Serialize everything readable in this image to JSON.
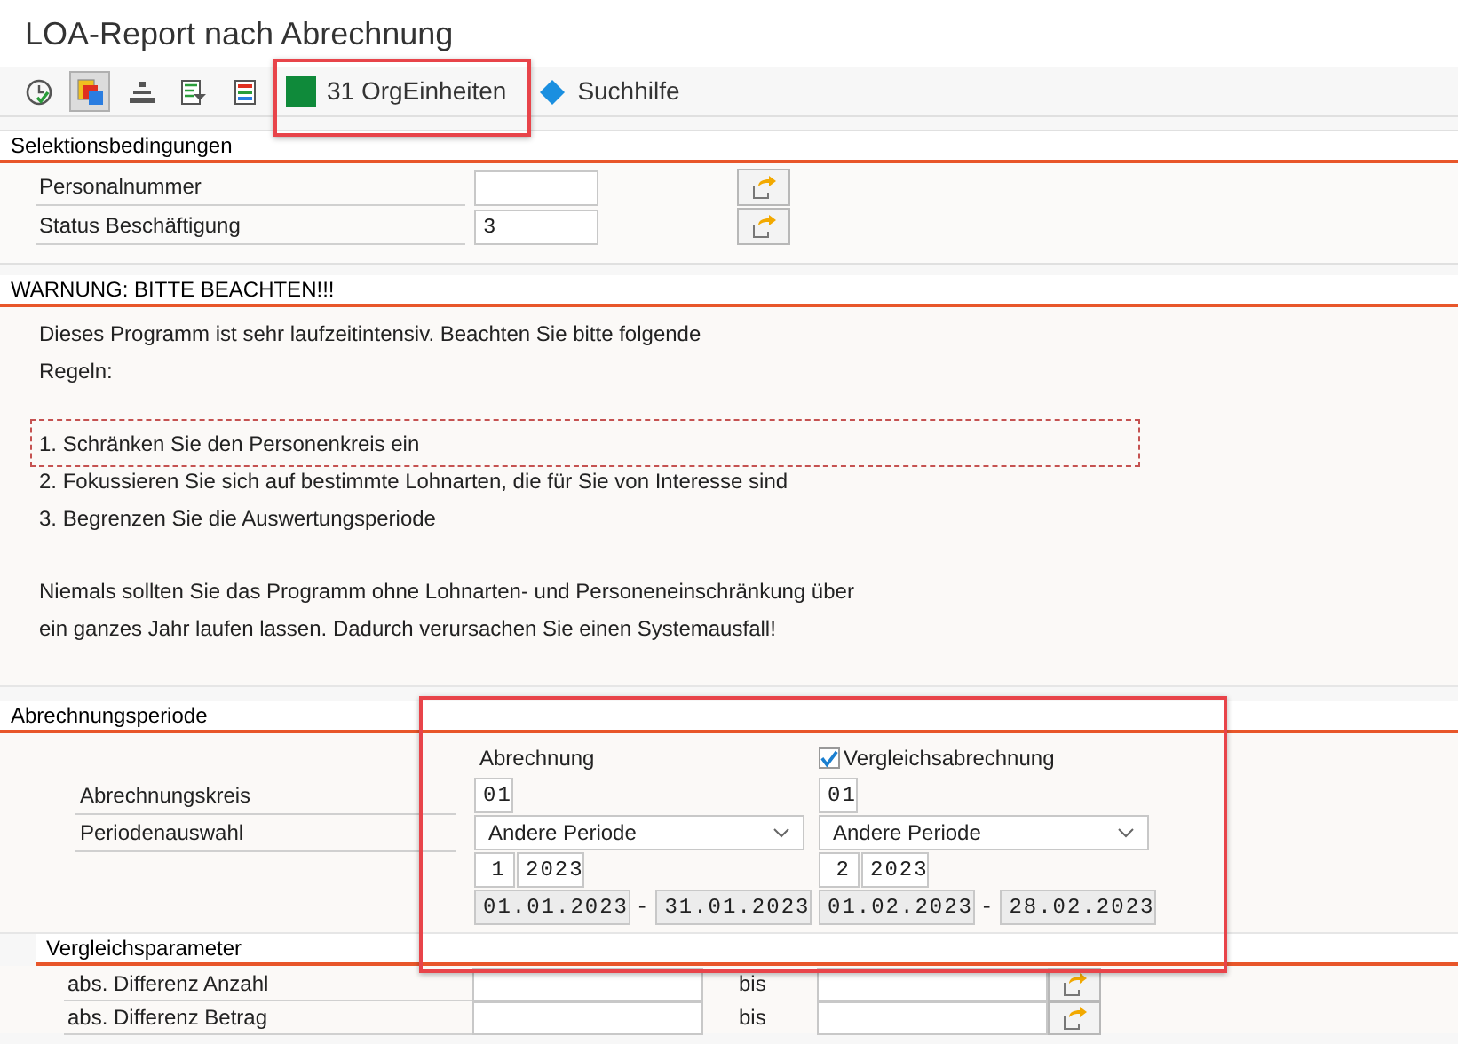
{
  "window": {
    "title": "LOA-Report nach Abrechnung"
  },
  "toolbar": {
    "icon_buttons": [
      {
        "kind": "clock-check",
        "selected": false
      },
      {
        "kind": "copy-squares",
        "selected": true
      },
      {
        "kind": "stack",
        "selected": false
      },
      {
        "kind": "filter-list",
        "selected": false
      },
      {
        "kind": "color-list",
        "selected": false
      }
    ],
    "text_buttons": [
      {
        "kind": "square",
        "label": "31 OrgEinheiten"
      },
      {
        "kind": "diamond",
        "label": "Suchhilfe"
      }
    ]
  },
  "selection": {
    "title": "Selektionsbedingungen",
    "fields": [
      {
        "label": "Personalnummer"
      },
      {
        "label": "Status Beschäftigung",
        "value": "3"
      }
    ]
  },
  "warning": {
    "title": "WARNUNG: BITTE BEACHTEN!!!",
    "paragraphs": [
      [
        {
          "text": "Dieses Programm ist sehr laufzeitintensiv. Beachten Sie bitte folgende",
          "focused": false
        },
        {
          "text": "Regeln:",
          "focused": false
        }
      ],
      [
        {
          "text": "1. Schränken Sie den Personenkreis ein",
          "focused": true
        },
        {
          "text": "2. Fokussieren Sie sich auf bestimmte Lohnarten, die für Sie von Interesse sind",
          "focused": false
        },
        {
          "text": "3. Begrenzen Sie die Auswertungsperiode",
          "focused": false
        }
      ],
      [
        {
          "text": "Niemals sollten Sie das Programm ohne Lohnarten- und Personeneinschränkung über",
          "focused": false
        },
        {
          "text": "ein ganzes Jahr laufen lassen. Dadurch verursachen Sie einen Systemausfall!",
          "focused": false
        }
      ]
    ]
  },
  "period": {
    "title": "Abrechnungsperiode",
    "row_labels": [
      "Abrechnungskreis",
      "Periodenauswahl"
    ],
    "columns": [
      {
        "kind": "label",
        "header": "Abrechnung",
        "area": "01",
        "selection": "Andere Periode",
        "period": "1",
        "year": "2023",
        "from": "01.01.2023",
        "dash": "-",
        "to": "31.01.2023"
      },
      {
        "kind": "checkbox",
        "checked": true,
        "header": "Vergleichsabrechnung",
        "area": "01",
        "selection": "Andere Periode",
        "period": "2",
        "year": "2023",
        "from": "01.02.2023",
        "dash": "-",
        "to": "28.02.2023"
      }
    ]
  },
  "compare": {
    "title": "Vergleichsparameter",
    "rows": [
      {
        "label": "abs. Differenz Anzahl",
        "to_label": "bis"
      },
      {
        "label": "abs. Differenz Betrag",
        "to_label": "bis"
      }
    ]
  }
}
